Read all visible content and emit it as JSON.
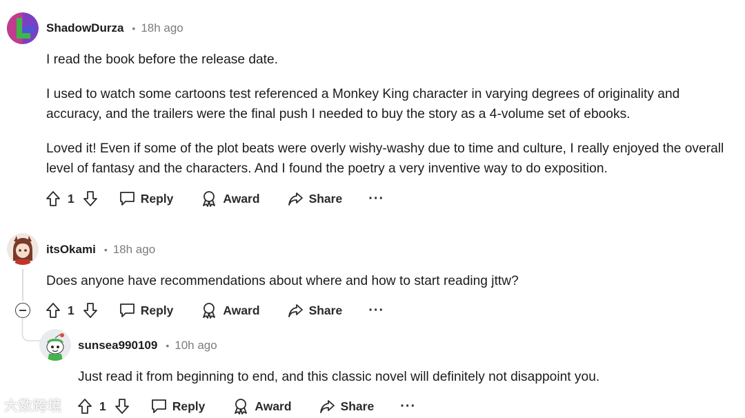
{
  "comments": [
    {
      "username": "ShadowDurza",
      "time": "18h ago",
      "paragraphs": [
        "I read the book before the release date.",
        "I used to watch some cartoons test referenced a Monkey King character in varying degrees of originality and accuracy, and the trailers were the final push I needed to buy the story as a 4-volume set of ebooks.",
        "Loved it! Even if some of the plot beats were overly wishy-washy due to time and culture, I really enjoyed the overall level of fantasy and the characters. And I found the poetry a very inventive way to do exposition."
      ],
      "votes": "1"
    },
    {
      "username": "itsOkami",
      "time": "18h ago",
      "paragraphs": [
        "Does anyone have recommendations about where and how to start reading jttw?"
      ],
      "votes": "1"
    },
    {
      "username": "sunsea990109",
      "time": "10h ago",
      "paragraphs": [
        "Just read it from beginning to end, and this classic novel will definitely not disappoint you."
      ],
      "votes": "1"
    }
  ],
  "actions": {
    "reply": "Reply",
    "award": "Award",
    "share": "Share",
    "more": "···"
  },
  "separator": "•",
  "watermark": "大数跨境",
  "icons": [
    "upvote-icon",
    "downvote-icon",
    "reply-icon",
    "award-icon",
    "share-icon",
    "more-icon",
    "collapse-icon"
  ],
  "colors": {
    "text": "#1c1c1c",
    "muted": "#7c7c7c",
    "thread": "#dcdcdc"
  }
}
